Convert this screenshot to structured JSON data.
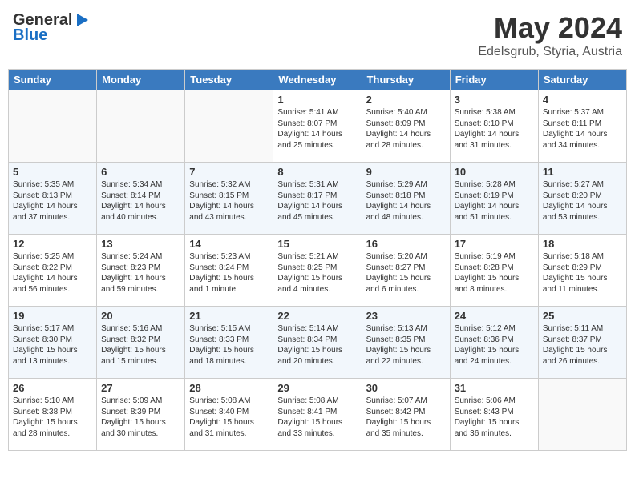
{
  "header": {
    "logo_general": "General",
    "logo_blue": "Blue",
    "title": "May 2024",
    "location": "Edelsgrub, Styria, Austria"
  },
  "days_of_week": [
    "Sunday",
    "Monday",
    "Tuesday",
    "Wednesday",
    "Thursday",
    "Friday",
    "Saturday"
  ],
  "weeks": [
    [
      {
        "day": "",
        "info": ""
      },
      {
        "day": "",
        "info": ""
      },
      {
        "day": "",
        "info": ""
      },
      {
        "day": "1",
        "info": "Sunrise: 5:41 AM\nSunset: 8:07 PM\nDaylight: 14 hours\nand 25 minutes."
      },
      {
        "day": "2",
        "info": "Sunrise: 5:40 AM\nSunset: 8:09 PM\nDaylight: 14 hours\nand 28 minutes."
      },
      {
        "day": "3",
        "info": "Sunrise: 5:38 AM\nSunset: 8:10 PM\nDaylight: 14 hours\nand 31 minutes."
      },
      {
        "day": "4",
        "info": "Sunrise: 5:37 AM\nSunset: 8:11 PM\nDaylight: 14 hours\nand 34 minutes."
      }
    ],
    [
      {
        "day": "5",
        "info": "Sunrise: 5:35 AM\nSunset: 8:13 PM\nDaylight: 14 hours\nand 37 minutes."
      },
      {
        "day": "6",
        "info": "Sunrise: 5:34 AM\nSunset: 8:14 PM\nDaylight: 14 hours\nand 40 minutes."
      },
      {
        "day": "7",
        "info": "Sunrise: 5:32 AM\nSunset: 8:15 PM\nDaylight: 14 hours\nand 43 minutes."
      },
      {
        "day": "8",
        "info": "Sunrise: 5:31 AM\nSunset: 8:17 PM\nDaylight: 14 hours\nand 45 minutes."
      },
      {
        "day": "9",
        "info": "Sunrise: 5:29 AM\nSunset: 8:18 PM\nDaylight: 14 hours\nand 48 minutes."
      },
      {
        "day": "10",
        "info": "Sunrise: 5:28 AM\nSunset: 8:19 PM\nDaylight: 14 hours\nand 51 minutes."
      },
      {
        "day": "11",
        "info": "Sunrise: 5:27 AM\nSunset: 8:20 PM\nDaylight: 14 hours\nand 53 minutes."
      }
    ],
    [
      {
        "day": "12",
        "info": "Sunrise: 5:25 AM\nSunset: 8:22 PM\nDaylight: 14 hours\nand 56 minutes."
      },
      {
        "day": "13",
        "info": "Sunrise: 5:24 AM\nSunset: 8:23 PM\nDaylight: 14 hours\nand 59 minutes."
      },
      {
        "day": "14",
        "info": "Sunrise: 5:23 AM\nSunset: 8:24 PM\nDaylight: 15 hours\nand 1 minute."
      },
      {
        "day": "15",
        "info": "Sunrise: 5:21 AM\nSunset: 8:25 PM\nDaylight: 15 hours\nand 4 minutes."
      },
      {
        "day": "16",
        "info": "Sunrise: 5:20 AM\nSunset: 8:27 PM\nDaylight: 15 hours\nand 6 minutes."
      },
      {
        "day": "17",
        "info": "Sunrise: 5:19 AM\nSunset: 8:28 PM\nDaylight: 15 hours\nand 8 minutes."
      },
      {
        "day": "18",
        "info": "Sunrise: 5:18 AM\nSunset: 8:29 PM\nDaylight: 15 hours\nand 11 minutes."
      }
    ],
    [
      {
        "day": "19",
        "info": "Sunrise: 5:17 AM\nSunset: 8:30 PM\nDaylight: 15 hours\nand 13 minutes."
      },
      {
        "day": "20",
        "info": "Sunrise: 5:16 AM\nSunset: 8:32 PM\nDaylight: 15 hours\nand 15 minutes."
      },
      {
        "day": "21",
        "info": "Sunrise: 5:15 AM\nSunset: 8:33 PM\nDaylight: 15 hours\nand 18 minutes."
      },
      {
        "day": "22",
        "info": "Sunrise: 5:14 AM\nSunset: 8:34 PM\nDaylight: 15 hours\nand 20 minutes."
      },
      {
        "day": "23",
        "info": "Sunrise: 5:13 AM\nSunset: 8:35 PM\nDaylight: 15 hours\nand 22 minutes."
      },
      {
        "day": "24",
        "info": "Sunrise: 5:12 AM\nSunset: 8:36 PM\nDaylight: 15 hours\nand 24 minutes."
      },
      {
        "day": "25",
        "info": "Sunrise: 5:11 AM\nSunset: 8:37 PM\nDaylight: 15 hours\nand 26 minutes."
      }
    ],
    [
      {
        "day": "26",
        "info": "Sunrise: 5:10 AM\nSunset: 8:38 PM\nDaylight: 15 hours\nand 28 minutes."
      },
      {
        "day": "27",
        "info": "Sunrise: 5:09 AM\nSunset: 8:39 PM\nDaylight: 15 hours\nand 30 minutes."
      },
      {
        "day": "28",
        "info": "Sunrise: 5:08 AM\nSunset: 8:40 PM\nDaylight: 15 hours\nand 31 minutes."
      },
      {
        "day": "29",
        "info": "Sunrise: 5:08 AM\nSunset: 8:41 PM\nDaylight: 15 hours\nand 33 minutes."
      },
      {
        "day": "30",
        "info": "Sunrise: 5:07 AM\nSunset: 8:42 PM\nDaylight: 15 hours\nand 35 minutes."
      },
      {
        "day": "31",
        "info": "Sunrise: 5:06 AM\nSunset: 8:43 PM\nDaylight: 15 hours\nand 36 minutes."
      },
      {
        "day": "",
        "info": ""
      }
    ]
  ]
}
